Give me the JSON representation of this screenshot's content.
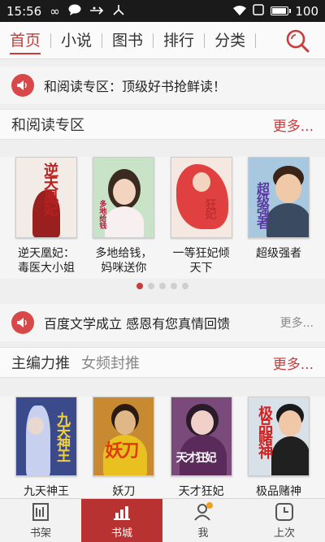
{
  "statusbar": {
    "time": "15:56",
    "battery": "100",
    "battery_level": 1.0
  },
  "nav": {
    "tabs": [
      {
        "label": "首页",
        "active": true
      },
      {
        "label": "小说"
      },
      {
        "label": "图书"
      },
      {
        "label": "排行"
      },
      {
        "label": "分类"
      }
    ]
  },
  "notice1": {
    "text": "和阅读专区：顶级好书抢鲜读！"
  },
  "section1": {
    "title": "和阅读专区",
    "more": "更多..."
  },
  "books1": [
    {
      "title": "逆天凰妃：\n毒医大小姐",
      "cover_text": "逆天凰妃",
      "bg": "#f3ece6",
      "text_color": "#b82020"
    },
    {
      "title": "多地给钱，\n妈咪送你",
      "cover_text": "多地给钱",
      "bg": "#c9e3c9",
      "text_color": "#b02040"
    },
    {
      "title": "一等狂妃倾\n天下",
      "cover_text": "狂妃",
      "bg": "#f4e8e0",
      "text_color": "#c03030"
    },
    {
      "title": "超级强者",
      "cover_text": "超级强者",
      "bg": "#a8c8e0",
      "text_color": "#5a3aa0"
    }
  ],
  "carousel": {
    "count": 5,
    "active": 0
  },
  "notice2": {
    "text": "百度文学成立 感恩有您真情回馈",
    "more": "更多..."
  },
  "section2": {
    "title": "主编力推",
    "title2": "女频封推",
    "more": "更多..."
  },
  "books2": [
    {
      "title": "九天神王",
      "cover_text": "九天神王",
      "bg": "#3a4a8a",
      "text_color": "#f0d040"
    },
    {
      "title": "妖刀",
      "cover_text": "妖刀",
      "bg": "#c88a30",
      "text_color": "#e03a10"
    },
    {
      "title": "天才狂妃",
      "cover_text": "天才狂妃",
      "bg": "#7a4a7a",
      "text_color": "#ffffff"
    },
    {
      "title": "极品赌神",
      "cover_text": "极品赌神",
      "bg": "#d8e0e8",
      "text_color": "#d02020"
    }
  ],
  "tabbar": {
    "tabs": [
      {
        "label": "书架",
        "icon": "bookshelf-icon"
      },
      {
        "label": "书城",
        "icon": "bookstore-icon",
        "active": true
      },
      {
        "label": "我",
        "icon": "profile-icon"
      },
      {
        "label": "上次",
        "icon": "clock-icon"
      }
    ]
  },
  "colors": {
    "accent": "#c83c3c",
    "tab_active_bg": "#b83232"
  }
}
